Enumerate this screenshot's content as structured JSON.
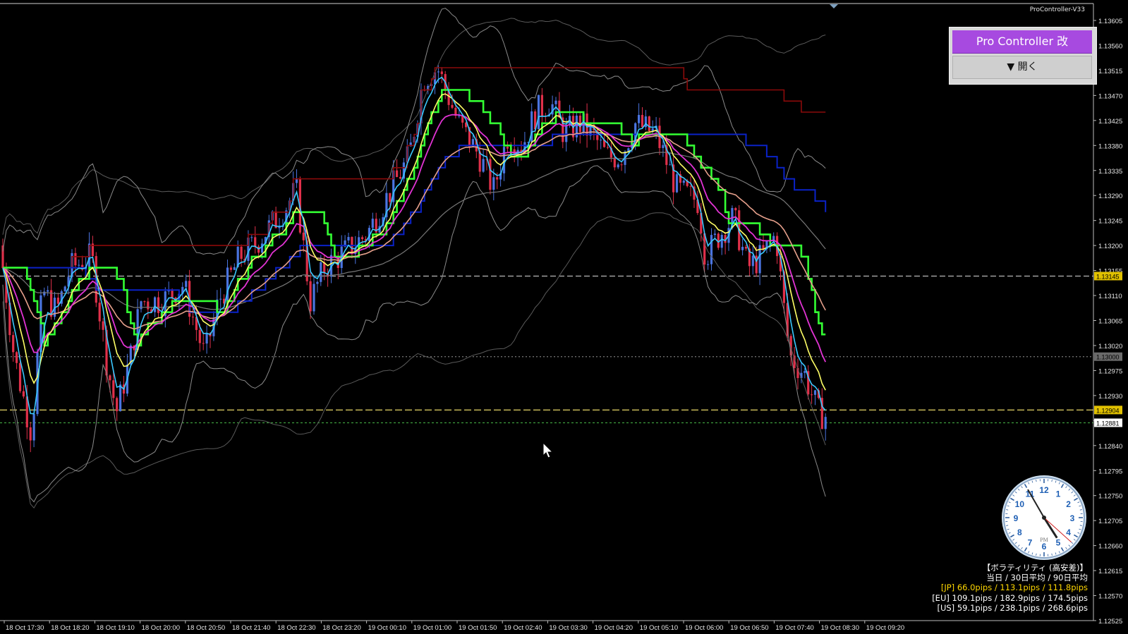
{
  "window": {
    "title": "ProController-V33"
  },
  "panel": {
    "title": "Pro Controller 改",
    "open_label": "▼ 開く"
  },
  "price_axis": {
    "ticks": [
      "1.13605",
      "1.13560",
      "1.13515",
      "1.13470",
      "1.13425",
      "1.13380",
      "1.13335",
      "1.13290",
      "1.13245",
      "1.13200",
      "1.13155",
      "1.13110",
      "1.13065",
      "1.13020",
      "1.12975",
      "1.12930",
      "1.12885",
      "1.12840",
      "1.12795",
      "1.12750",
      "1.12705",
      "1.12660",
      "1.12615",
      "1.12570",
      "1.12525"
    ],
    "markers": [
      {
        "label": "1.13145",
        "color": "#e0c000",
        "text_color": "#000"
      },
      {
        "label": "1.13000",
        "color": "#6a6a6a",
        "text_color": "#000"
      },
      {
        "label": "1.12904",
        "color": "#e0c000",
        "text_color": "#000"
      },
      {
        "label": "1.12881",
        "color": "#ffffff",
        "text_color": "#000"
      }
    ]
  },
  "time_axis": {
    "labels": [
      "18 Oct 17:30",
      "18 Oct 18:20",
      "18 Oct 19:10",
      "18 Oct 20:00",
      "18 Oct 20:50",
      "18 Oct 21:40",
      "18 Oct 22:30",
      "18 Oct 23:20",
      "19 Oct 00:10",
      "19 Oct 01:00",
      "19 Oct 01:50",
      "19 Oct 02:40",
      "19 Oct 03:30",
      "19 Oct 04:20",
      "19 Oct 05:10",
      "19 Oct 06:00",
      "19 Oct 06:50",
      "19 Oct 07:40",
      "19 Oct 08:30",
      "19 Oct 09:20"
    ]
  },
  "clock": {
    "period": "PM",
    "hour": 4,
    "minute": 55
  },
  "volatility": {
    "title": "【ボラティリティ (高安差)】",
    "subtitle": "当日 / 30日平均 / 90日平均",
    "rows": [
      {
        "text": "[JP] 66.0pips / 113.1pips / 111.8pips",
        "color": "#ffd700"
      },
      {
        "text": "[EU] 109.1pips / 182.9pips / 174.5pips",
        "color": "#ffffff"
      },
      {
        "text": "[US] 59.1pips / 238.1pips / 268.6pips",
        "color": "#ffffff"
      }
    ]
  },
  "colors": {
    "bull": "#4a74e0",
    "bear": "#e0304a",
    "accent": "#a74ae0"
  }
}
